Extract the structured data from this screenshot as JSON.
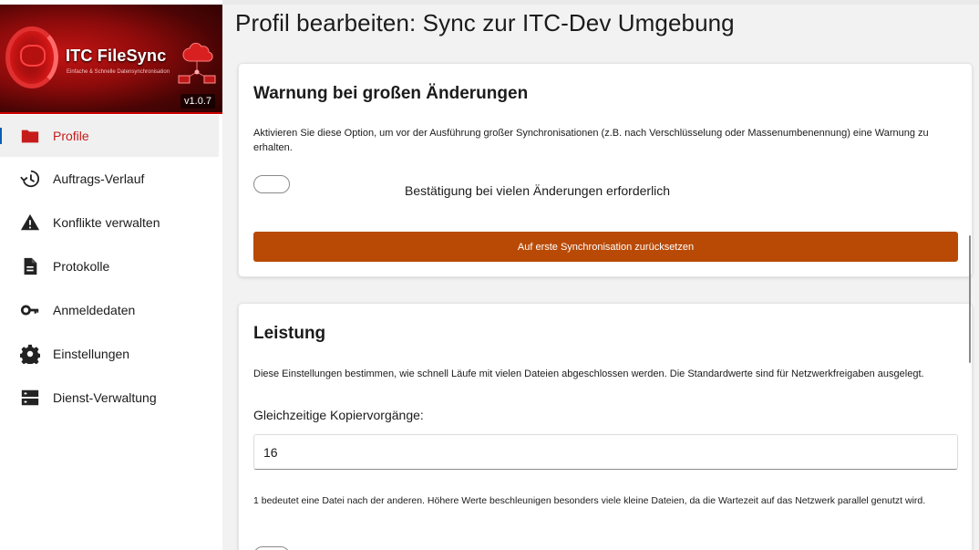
{
  "app": {
    "brand": "ITC FileSync",
    "tagline": "Einfache & Schnelle Datensynchronisation",
    "version": "v1.0.7",
    "accent": "#c61b1b",
    "button_color": "#b94a06"
  },
  "nav": {
    "items": [
      {
        "label": "Profile",
        "icon": "folder-icon",
        "active": true
      },
      {
        "label": "Auftrags-Verlauf",
        "icon": "history-icon"
      },
      {
        "label": "Konflikte verwalten",
        "icon": "warning-icon"
      },
      {
        "label": "Protokolle",
        "icon": "document-icon"
      },
      {
        "label": "Anmeldedaten",
        "icon": "key-icon"
      },
      {
        "label": "Einstellungen",
        "icon": "gear-icon"
      },
      {
        "label": "Dienst-Verwaltung",
        "icon": "server-icon"
      }
    ]
  },
  "page": {
    "title": "Profil bearbeiten: Sync zur ITC-Dev Umgebung"
  },
  "warning_card": {
    "title": "Warnung bei großen Änderungen",
    "description": "Aktivieren Sie diese Option, um vor der Ausführung großer Synchronisationen (z.B. nach Verschlüsselung oder Massenumbenennung) eine Warnung zu erhalten.",
    "toggle_label": "Bestätigung bei vielen Änderungen erforderlich",
    "toggle_on": false,
    "reset_button": "Auf erste Synchronisation zurücksetzen"
  },
  "performance_card": {
    "title": "Leistung",
    "description": "Diese Einstellungen bestimmen, wie schnell Läufe mit vielen Dateien abgeschlossen werden. Die Standardwerte sind für Netzwerkfreigaben ausgelegt.",
    "concurrent_label": "Gleichzeitige Kopiervorgänge:",
    "concurrent_value": "16",
    "concurrent_help": "1 bedeutet eine Datei nach der anderen. Höhere Werte beschleunigen besonders viele kleine Dateien, da die Wartezeit auf das Netzwerk parallel genutzt wird."
  }
}
